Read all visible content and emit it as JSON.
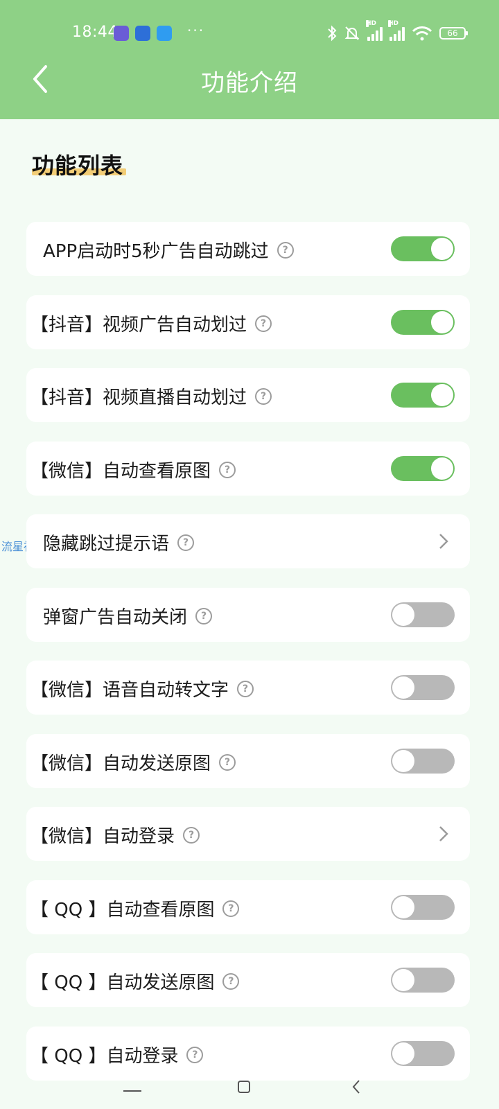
{
  "status_bar": {
    "time": "18:44",
    "more": "···",
    "battery": "66",
    "network_badge": "HD"
  },
  "header": {
    "title": "功能介绍"
  },
  "section": {
    "title": "功能列表"
  },
  "watermark": "流星社区",
  "features": [
    {
      "label": "APP启动时5秒广告自动跳过",
      "control": "toggle",
      "enabled": true
    },
    {
      "label": "【抖音】视频广告自动划过",
      "control": "toggle",
      "enabled": true
    },
    {
      "label": "【抖音】视频直播自动划过",
      "control": "toggle",
      "enabled": true
    },
    {
      "label": "【微信】自动查看原图",
      "control": "toggle",
      "enabled": true
    },
    {
      "label": "隐藏跳过提示语",
      "control": "chevron"
    },
    {
      "label": "弹窗广告自动关闭",
      "control": "toggle",
      "enabled": false
    },
    {
      "label": "【微信】语音自动转文字",
      "control": "toggle",
      "enabled": false
    },
    {
      "label": "【微信】自动发送原图",
      "control": "toggle",
      "enabled": false
    },
    {
      "label": "【微信】自动登录",
      "control": "chevron"
    },
    {
      "label": "【 QQ 】自动查看原图",
      "control": "toggle",
      "enabled": false
    },
    {
      "label": "【 QQ 】自动发送原图",
      "control": "toggle",
      "enabled": false
    },
    {
      "label": "【 QQ 】自动登录",
      "control": "toggle",
      "enabled": false
    }
  ],
  "colors": {
    "header": "#8ed186",
    "toggle_on": "#6abf5f",
    "toggle_off": "#b8b8b8",
    "underline": "#f2c868"
  }
}
